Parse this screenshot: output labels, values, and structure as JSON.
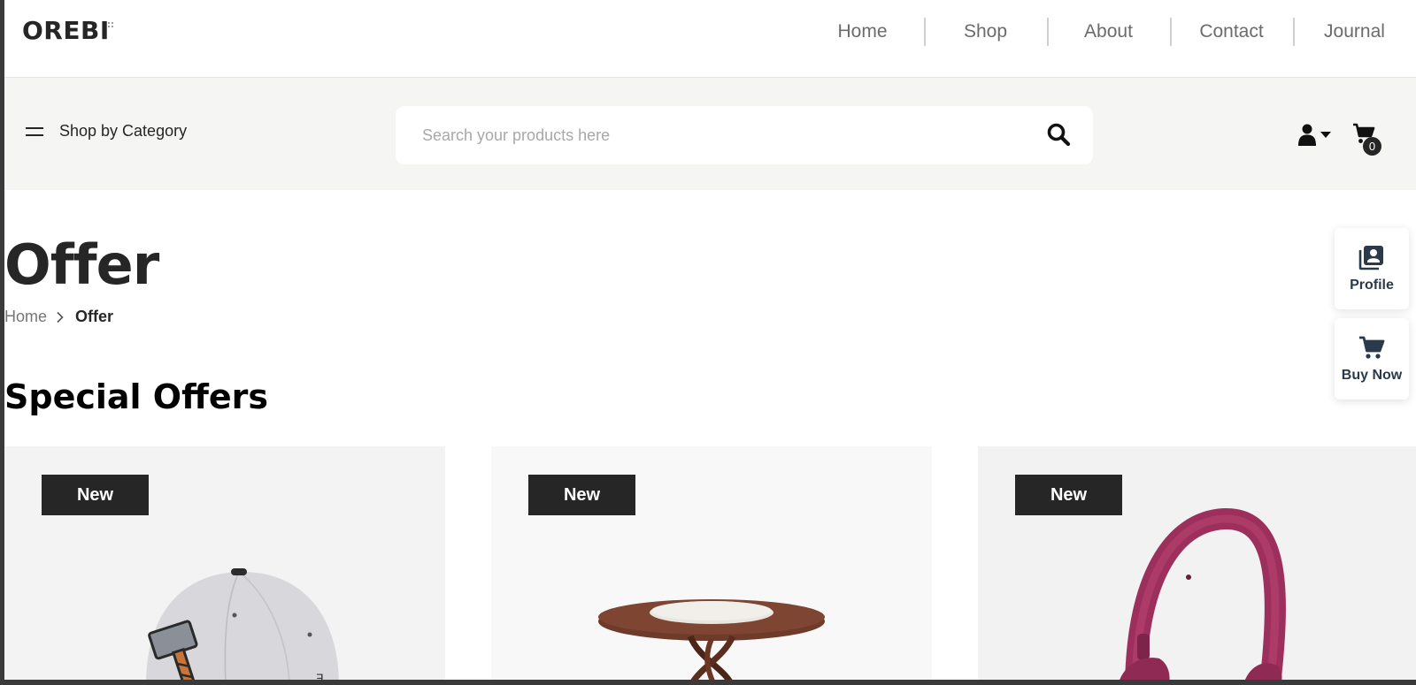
{
  "brand": {
    "logo_text": "OREBI"
  },
  "nav": {
    "items": [
      {
        "label": "Home"
      },
      {
        "label": "Shop"
      },
      {
        "label": "About"
      },
      {
        "label": "Contact"
      },
      {
        "label": "Journal"
      }
    ]
  },
  "toolbar": {
    "category_label": "Shop by Category",
    "category_icon": "menu-icon",
    "search": {
      "placeholder": "Search your products here",
      "value": "",
      "icon": "search-icon"
    },
    "user_icon": "user-icon",
    "cart": {
      "icon": "cart-icon",
      "count": "0"
    }
  },
  "page": {
    "title": "Offer",
    "breadcrumb": {
      "home": "Home",
      "current": "Offer"
    },
    "section_title": "Special Offers"
  },
  "products": [
    {
      "badge": "New",
      "image": "cap-image"
    },
    {
      "badge": "New",
      "image": "table-image"
    },
    {
      "badge": "New",
      "image": "headphones-image"
    }
  ],
  "side_widgets": {
    "profile": {
      "label": "Profile",
      "icon": "profile-icon"
    },
    "buy_now": {
      "label": "Buy Now",
      "icon": "cart-icon"
    }
  },
  "colors": {
    "primary_dark": "#262626",
    "band_background": "#f5f5f3",
    "widget_text": "#2b3a4a"
  }
}
